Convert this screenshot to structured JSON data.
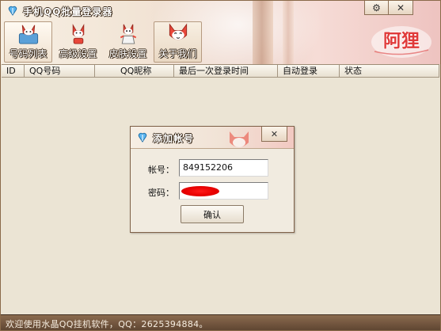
{
  "window": {
    "title": "手机QQ批量登录器",
    "controls": {
      "settings": "⚙",
      "close": "✕"
    },
    "brand_logo_text": "阿狸"
  },
  "toolbar": {
    "items": [
      {
        "label": "号码列表",
        "icon": "fox-icon-list"
      },
      {
        "label": "高级设置",
        "icon": "fox-icon-advanced"
      },
      {
        "label": "皮肤设置",
        "icon": "fox-icon-skin"
      },
      {
        "label": "关于我们",
        "icon": "fox-icon-about"
      }
    ]
  },
  "table": {
    "columns": [
      "ID",
      "QQ号码",
      "QQ昵称",
      "最后一次登录时间",
      "自动登录",
      "状态"
    ],
    "rows": []
  },
  "status_bar": {
    "text": "欢迎使用水晶QQ挂机软件，QQ：2625394884。"
  },
  "dialog": {
    "title": "添加帐号",
    "close": "✕",
    "account_label": "帐号：",
    "account_value": "849152206",
    "password_label": "密码：",
    "confirm_label": "确认"
  },
  "colors": {
    "status_bar": "#6d5039",
    "scribble": "#e60000",
    "window_border": "#8a6a4a"
  }
}
